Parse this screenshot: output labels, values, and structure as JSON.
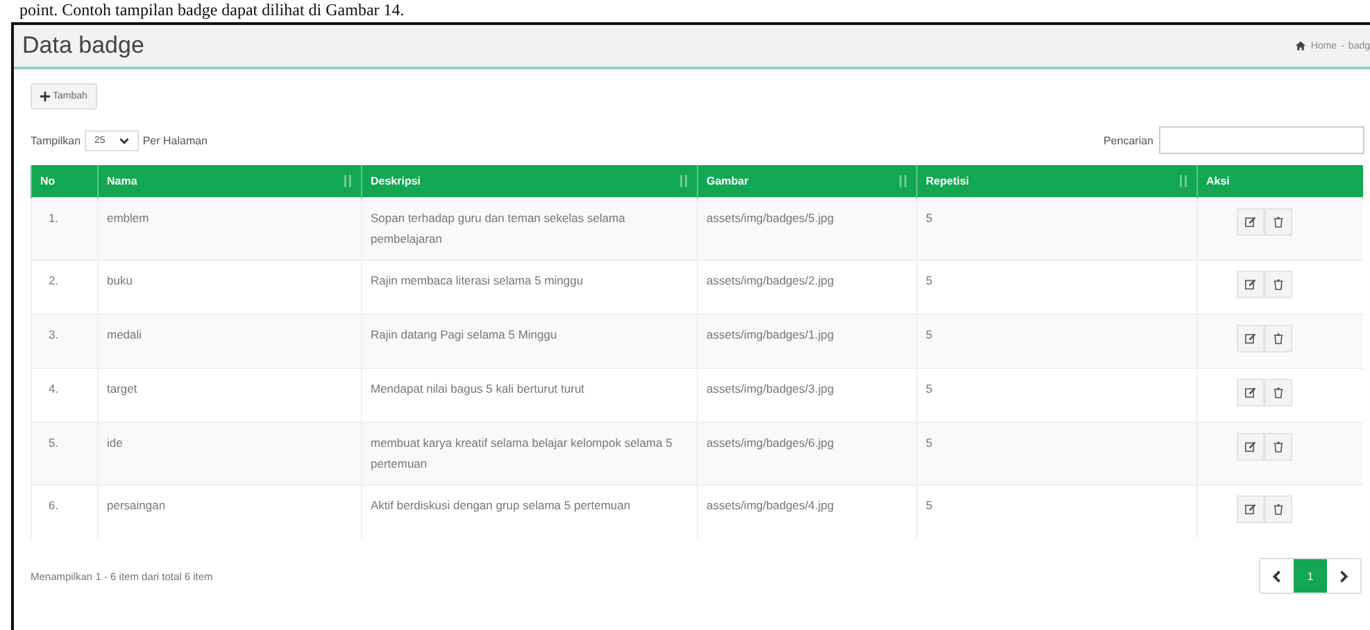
{
  "caption": "point. Contoh tampilan badge dapat dilihat di Gambar 14.",
  "page": {
    "title": "Data badge",
    "breadcrumb": [
      "Home",
      "badg"
    ],
    "breadcrumb_separator": "-"
  },
  "add_button": {
    "label": "Tambah"
  },
  "length_control": {
    "prefix": "Tampilkan",
    "value": "25",
    "suffix": "Per Halaman"
  },
  "search": {
    "label": "Pencarian"
  },
  "table": {
    "columns": [
      {
        "label": "No",
        "sortable": false
      },
      {
        "label": "Nama",
        "sortable": true
      },
      {
        "label": "Deskripsi",
        "sortable": true
      },
      {
        "label": "Gambar",
        "sortable": true
      },
      {
        "label": "Repetisi",
        "sortable": true
      },
      {
        "label": "Aksi",
        "sortable": false
      }
    ],
    "rows": [
      {
        "no": "1.",
        "nama": "emblem",
        "deskripsi": "Sopan terhadap guru dan teman sekelas selama pembelajaran",
        "gambar": "assets/img/badges/5.jpg",
        "repetisi": "5"
      },
      {
        "no": "2.",
        "nama": "buku",
        "deskripsi": "Rajin membaca literasi selama 5 minggu",
        "gambar": "assets/img/badges/2.jpg",
        "repetisi": "5"
      },
      {
        "no": "3.",
        "nama": "medali",
        "deskripsi": "Rajin datang Pagi selama 5 Minggu",
        "gambar": "assets/img/badges/1.jpg",
        "repetisi": "5"
      },
      {
        "no": "4.",
        "nama": "target",
        "deskripsi": "Mendapat nilai bagus 5 kali berturut turut",
        "gambar": "assets/img/badges/3.jpg",
        "repetisi": "5"
      },
      {
        "no": "5.",
        "nama": "ide",
        "deskripsi": "membuat karya kreatif selama belajar kelompok selama 5 pertemuan",
        "gambar": "assets/img/badges/6.jpg",
        "repetisi": "5"
      },
      {
        "no": "6.",
        "nama": "persaingan",
        "deskripsi": "Aktif berdiskusi dengan grup selama 5 pertemuan",
        "gambar": "assets/img/badges/4.jpg",
        "repetisi": "5"
      }
    ]
  },
  "footer": {
    "info": "Menampilkan 1 - 6 item dari total 6 item",
    "pages": [
      {
        "label": "1",
        "selected": true
      }
    ]
  }
}
